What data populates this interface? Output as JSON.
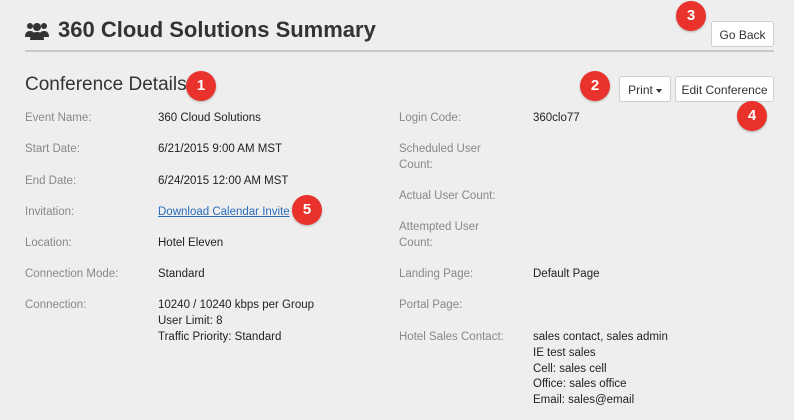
{
  "header": {
    "title": "360 Cloud Solutions Summary",
    "icon": "users-icon",
    "go_back_label": "Go Back"
  },
  "conference": {
    "section_title": "Conference Details",
    "print_label": "Print",
    "edit_label": "Edit Conference",
    "left": {
      "event_name_label": "Event Name:",
      "event_name": "360 Cloud Solutions",
      "start_date_label": "Start Date:",
      "start_date": "6/21/2015 9:00 AM MST",
      "end_date_label": "End Date:",
      "end_date": "6/24/2015 12:00 AM MST",
      "invitation_label": "Invitation:",
      "invitation_link": "Download Calendar Invite",
      "location_label": "Location:",
      "location": "Hotel Eleven",
      "connection_mode_label": "Connection Mode:",
      "connection_mode": "Standard",
      "connection_label": "Connection:",
      "connection_lines": [
        "10240 / 10240 kbps per Group",
        "User Limit: 8",
        "Traffic Priority: Standard"
      ]
    },
    "right": {
      "login_code_label": "Login Code:",
      "login_code": "360clo77",
      "scheduled_user_label_1": "Scheduled User",
      "scheduled_user_label_2": "Count:",
      "actual_user_label": "Actual User Count:",
      "attempted_user_label_1": "Attempted User",
      "attempted_user_label_2": "Count:",
      "landing_page_label": "Landing Page:",
      "landing_page": "Default Page",
      "portal_page_label": "Portal Page:",
      "hotel_sales_label": "Hotel Sales Contact:",
      "hotel_sales_lines": [
        "sales contact, sales admin",
        "IE test sales",
        "Cell: sales cell",
        "Office: sales office",
        "Email: sales@email"
      ]
    }
  },
  "badges": [
    "1",
    "2",
    "3",
    "4",
    "5"
  ],
  "colors": {
    "badge": "#e8322b",
    "link": "#2a6ebb",
    "background": "#eeeeee"
  }
}
